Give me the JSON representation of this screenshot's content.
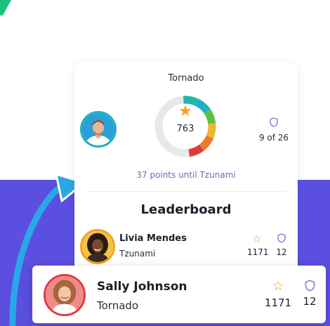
{
  "header": {
    "rank_name": "Tornado",
    "points": "763",
    "rank_position": "9 of 26",
    "points_until": "37 points until Tzunami"
  },
  "leaderboard": {
    "title": "Leaderboard",
    "entries": [
      {
        "name": "Livia Mendes",
        "rank": "Tzunami",
        "points": "1171",
        "badges": "12"
      }
    ]
  },
  "highlighted": {
    "name": "Sally Johnson",
    "rank": "Tornado",
    "points": "1171",
    "badges": "12"
  },
  "colors": {
    "accent_purple": "#5b4fe0",
    "arrow_blue": "#29a7e8",
    "brand_green": "#19c37d",
    "star_orange": "#f2a31b",
    "shield_purple": "#7b7ee0"
  },
  "gauge_segments": [
    "#20b7a8",
    "#1fb0c2",
    "#58c341",
    "#f0b52a",
    "#ee7a2c",
    "#e03a3f"
  ]
}
